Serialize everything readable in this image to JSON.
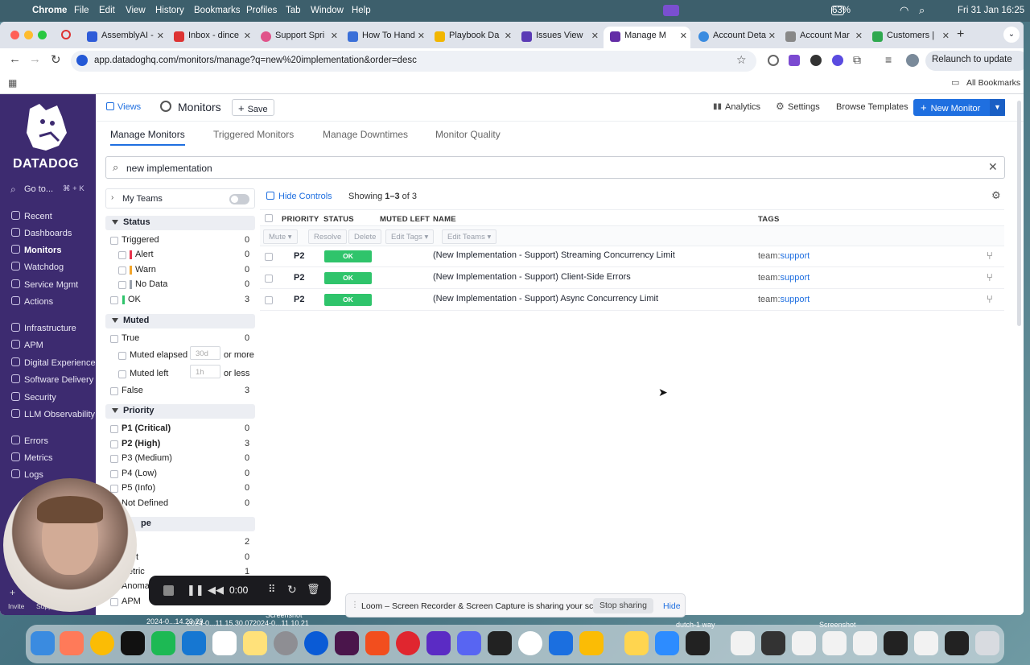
{
  "menubar": {
    "app": "Chrome",
    "items": [
      "File",
      "Edit",
      "View",
      "History",
      "Bookmarks",
      "Profiles",
      "Tab",
      "Window",
      "Help"
    ],
    "battery": "63%",
    "datetime": "Fri 31 Jan  16:25"
  },
  "tabs": [
    {
      "label": "AssemblyAI -"
    },
    {
      "label": "Inbox - dince"
    },
    {
      "label": "Support Spri"
    },
    {
      "label": "How To Hand"
    },
    {
      "label": "Playbook Da"
    },
    {
      "label": "Issues View"
    },
    {
      "label": "Manage M"
    },
    {
      "label": "Account Deta"
    },
    {
      "label": "Account Mar"
    },
    {
      "label": "Customers |"
    }
  ],
  "browser": {
    "url": "app.datadoghq.com/monitors/manage?q=new%20implementation&order=desc",
    "relaunch": "Relaunch to update",
    "all_bookmarks": "All Bookmarks"
  },
  "sidebar": {
    "brand": "DATADOG",
    "goto": "Go to...",
    "shortcut": "⌘ + K",
    "items": [
      "Recent",
      "Dashboards",
      "Monitors",
      "Watchdog",
      "Service Mgmt",
      "Actions",
      "Infrastructure",
      "APM",
      "Digital Experience",
      "Software Delivery",
      "Security",
      "LLM Observability",
      "Errors",
      "Metrics",
      "Logs"
    ],
    "bottom": [
      "Invite",
      "Support"
    ]
  },
  "header": {
    "views": "Views",
    "title": "Monitors",
    "save": "Save",
    "analytics": "Analytics",
    "settings": "Settings",
    "browse": "Browse Templates",
    "new_monitor": "New Monitor"
  },
  "subtabs": [
    "Manage Monitors",
    "Triggered Monitors",
    "Manage Downtimes",
    "Monitor Quality"
  ],
  "search": {
    "value": "new implementation"
  },
  "facets": {
    "my_teams": "My Teams",
    "status": {
      "title": "Status",
      "rows": [
        {
          "label": "Triggered",
          "count": "0"
        },
        {
          "label": "Alert",
          "count": "0"
        },
        {
          "label": "Warn",
          "count": "0"
        },
        {
          "label": "No Data",
          "count": "0"
        },
        {
          "label": "OK",
          "count": "3"
        }
      ]
    },
    "muted": {
      "title": "Muted",
      "true": "True",
      "true_count": "0",
      "elapsed": "Muted elapsed",
      "elapsed_ph": "30d",
      "or_more": "or more",
      "left": "Muted left",
      "left_ph": "1h",
      "or_less": "or less",
      "false": "False",
      "false_count": "3"
    },
    "priority": {
      "title": "Priority",
      "rows": [
        {
          "label": "P1 (Critical)",
          "count": "0"
        },
        {
          "label": "P2 (High)",
          "count": "3"
        },
        {
          "label": "P3 (Medium)",
          "count": "0"
        },
        {
          "label": "P4 (Low)",
          "count": "0"
        },
        {
          "label": "P5 (Info)",
          "count": "0"
        },
        {
          "label": "Not Defined",
          "count": "0"
        }
      ]
    },
    "type": {
      "title_partial": "pe",
      "rows": [
        {
          "label": "",
          "count": "2"
        },
        {
          "label": "t",
          "count": "0"
        },
        {
          "label": "etric",
          "count": "1"
        },
        {
          "label": "Anoma",
          "count": ""
        },
        {
          "label": "APM",
          "count": ""
        }
      ]
    }
  },
  "table": {
    "hide_controls": "Hide Controls",
    "showing_prefix": "Showing ",
    "showing_range": "1–3",
    "showing_suffix": " of 3",
    "headers": {
      "priority": "PRIORITY",
      "status": "STATUS",
      "muted_left": "MUTED LEFT",
      "name": "NAME",
      "tags": "TAGS"
    },
    "bulk": [
      "Mute",
      "Resolve",
      "Delete",
      "Edit Tags",
      "Edit Teams"
    ],
    "rows": [
      {
        "priority": "P2",
        "status": "OK",
        "name": "(New Implementation - Support) Streaming Concurrency Limit",
        "tag_key": "team:",
        "tag_val": "support"
      },
      {
        "priority": "P2",
        "status": "OK",
        "name": "(New Implementation - Support) Client-Side Errors",
        "tag_key": "team:",
        "tag_val": "support"
      },
      {
        "priority": "P2",
        "status": "OK",
        "name": "(New Implementation - Support) Async Concurrency Limit",
        "tag_key": "team:",
        "tag_val": "support"
      }
    ]
  },
  "loom": {
    "timer": "0:00",
    "banner": "Loom – Screen Recorder & Screen Capture is sharing your screen.",
    "stop": "Stop sharing",
    "hide": "Hide"
  },
  "desktop": {
    "files": [
      "2024-0...14.23.29",
      "2024-0...11.15.30.07",
      "2024-0...11.10.21",
      "Screenshot",
      "dutch-1 way",
      "Screenshot"
    ]
  },
  "colors": {
    "sidebar": "#3d2b70",
    "accent": "#632ca6",
    "primary_button": "#1f6fe0",
    "ok": "#2fc46b",
    "alert": "#e8344d",
    "warn": "#f2a52c"
  }
}
